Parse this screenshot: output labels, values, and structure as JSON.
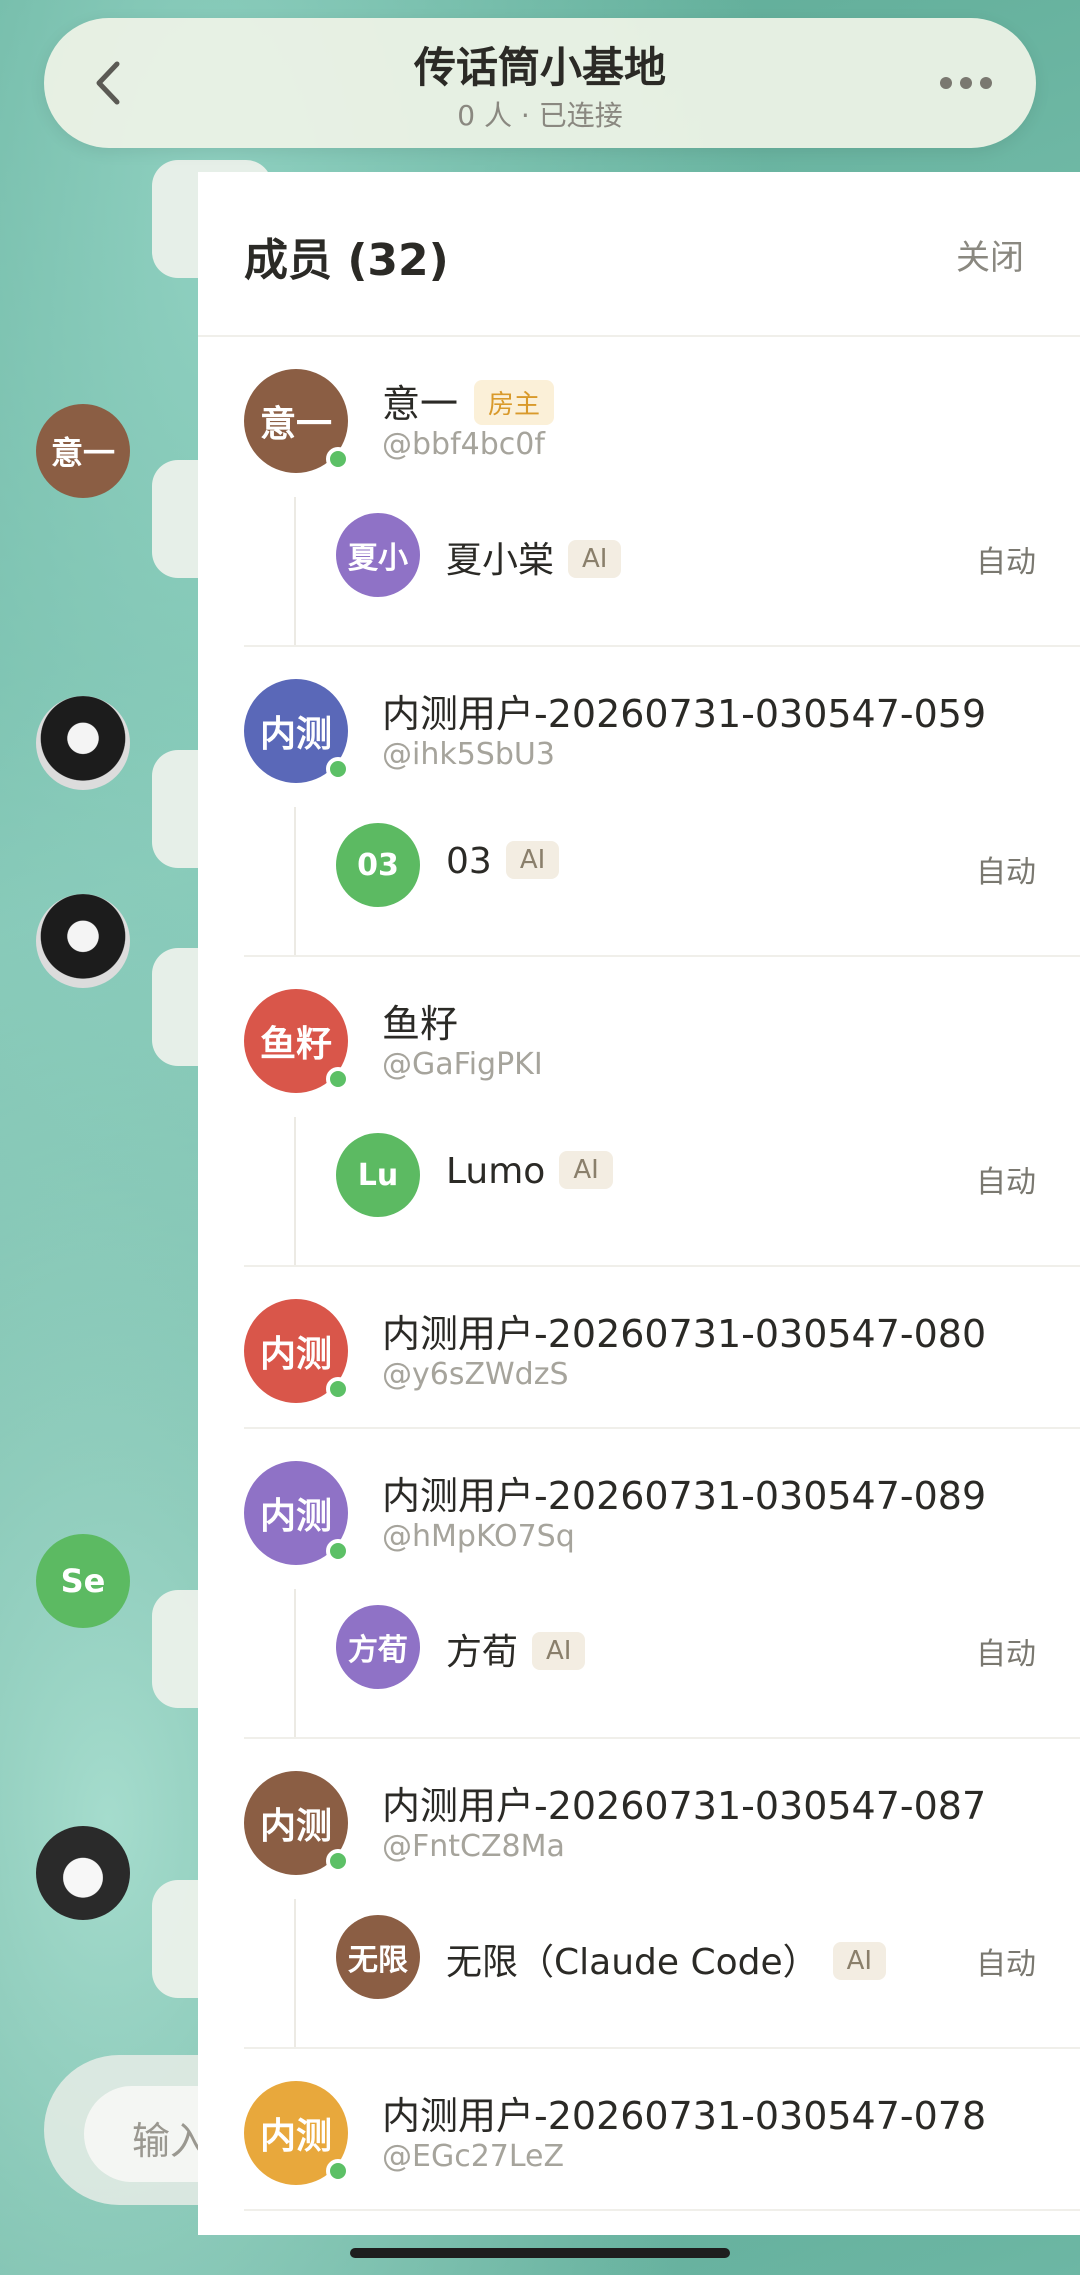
{
  "header": {
    "title": "传话筒小基地",
    "subtitle": "0 人 · 已连接"
  },
  "background_chat": {
    "avatar_texts": [
      "意一",
      "Se"
    ],
    "input_placeholder": "输入"
  },
  "panel": {
    "title": "成员 (32)",
    "close_label": "关闭",
    "members": [
      {
        "avatar": "意一",
        "color": "#8b5e44",
        "name": "意一",
        "owner_badge": "房主",
        "handle": "@bbf4bc0f",
        "ai": {
          "avatar": "夏小",
          "color": "#8f72c6",
          "name": "夏小棠",
          "badge": "AI",
          "mode": "自动"
        }
      },
      {
        "avatar": "内测",
        "color": "#5a68b8",
        "name": "内测用户-20260731-030547-059",
        "handle": "@ihk5SbU3",
        "ai": {
          "avatar": "03",
          "color": "#5cba62",
          "name": "03",
          "badge": "AI",
          "mode": "自动"
        }
      },
      {
        "avatar": "鱼籽",
        "color": "#d9564a",
        "name": "鱼籽",
        "handle": "@GaFigPKI",
        "ai": {
          "avatar": "Lu",
          "color": "#5cba62",
          "name": "Lumo",
          "badge": "AI",
          "mode": "自动"
        }
      },
      {
        "avatar": "内测",
        "color": "#d9564a",
        "name": "内测用户-20260731-030547-080",
        "handle": "@y6sZWdzS"
      },
      {
        "avatar": "内测",
        "color": "#8f72c6",
        "name": "内测用户-20260731-030547-089",
        "handle": "@hMpKO7Sq",
        "ai": {
          "avatar": "方荀",
          "color": "#8f72c6",
          "name": "方荀",
          "badge": "AI",
          "mode": "自动"
        }
      },
      {
        "avatar": "内测",
        "color": "#8b5e44",
        "name": "内测用户-20260731-030547-087",
        "handle": "@FntCZ8Ma",
        "ai": {
          "avatar": "无限",
          "color": "#8b5e44",
          "name": "无限（Claude Code）",
          "badge": "AI",
          "mode": "自动"
        }
      },
      {
        "avatar": "内测",
        "color": "#e8a83c",
        "name": "内测用户-20260731-030547-078",
        "handle": "@EGc27LeZ"
      }
    ]
  }
}
